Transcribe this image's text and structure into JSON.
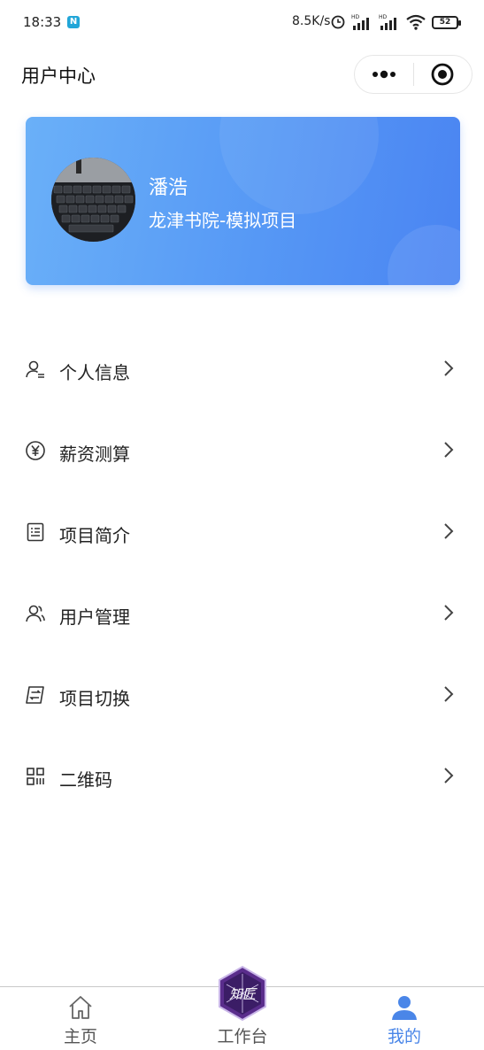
{
  "status_bar": {
    "time": "18:33",
    "app_badge": "N",
    "network_speed": "8.5K/s",
    "battery": "52"
  },
  "nav": {
    "title": "用户中心",
    "more_icon": "more-dots-icon",
    "close_icon": "target-circle-icon"
  },
  "profile": {
    "name": "潘浩",
    "project": "龙津书院-模拟项目",
    "avatar": "keyboard-photo"
  },
  "menu": {
    "items": [
      {
        "label": "个人信息",
        "icon": "user-info-icon"
      },
      {
        "label": "薪资测算",
        "icon": "yen-circle-icon"
      },
      {
        "label": "项目简介",
        "icon": "document-list-icon"
      },
      {
        "label": "用户管理",
        "icon": "users-icon"
      },
      {
        "label": "项目切换",
        "icon": "switch-project-icon"
      },
      {
        "label": "二维码",
        "icon": "qr-code-icon"
      }
    ]
  },
  "tabbar": {
    "tabs": [
      {
        "label": "主页",
        "icon": "home-icon"
      },
      {
        "label": "工作台",
        "icon": "workbench-emblem-icon"
      },
      {
        "label": "我的",
        "icon": "user-profile-icon"
      }
    ],
    "active_tab": "我的",
    "emblem_text": "知匠"
  },
  "colors": {
    "card_gradient_start": "#6ab0f8",
    "card_gradient_end": "#4a84f2",
    "active_tab": "#4a86e8",
    "emblem_purple": "#5a2d8c"
  }
}
